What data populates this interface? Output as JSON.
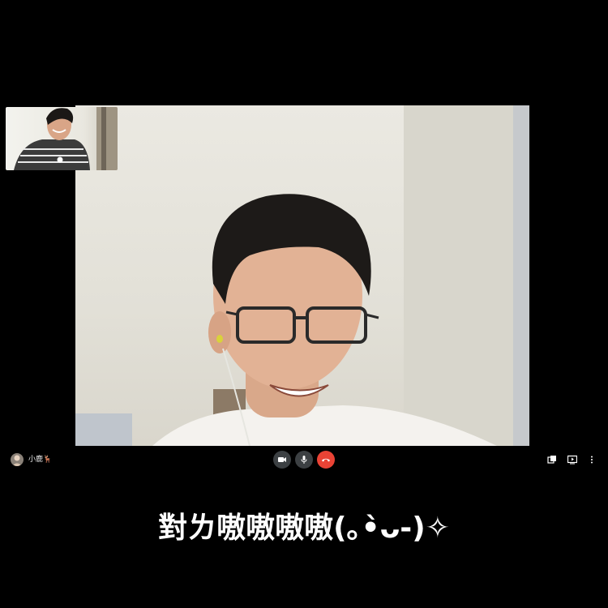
{
  "call": {
    "participant_name": "小鹿🦌"
  },
  "controls": {
    "camera": "camera-icon",
    "microphone": "microphone-icon",
    "hangup": "hang-up-icon",
    "layout": "layout-icon",
    "present": "present-screen-icon",
    "more": "more-vert-icon"
  },
  "caption": {
    "text": "對ㄌ嗷嗷嗷嗷(｡•̀ᴗ-)✧"
  },
  "colors": {
    "background": "#000000",
    "hangup_red": "#ea4335",
    "button_dark": "#3c4043"
  }
}
